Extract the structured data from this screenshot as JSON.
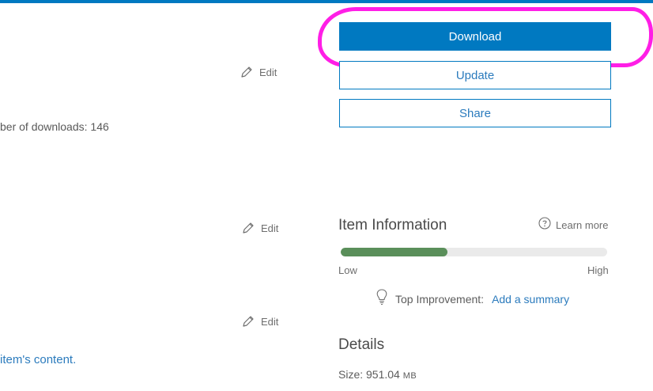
{
  "left": {
    "edit_label": "Edit",
    "downloads_text": "ber of downloads: 146",
    "content_link": "item's content."
  },
  "actions": {
    "download_label": "Download",
    "update_label": "Update",
    "share_label": "Share"
  },
  "item_information": {
    "title": "Item Information",
    "learn_more": "Learn more",
    "progress_fraction": 0.4,
    "low_label": "Low",
    "high_label": "High",
    "top_improvement_label": "Top Improvement:",
    "top_improvement_link": "Add a summary"
  },
  "details": {
    "title": "Details",
    "size_label": "Size: 951.04",
    "size_unit": "MB"
  },
  "colors": {
    "accent": "#0079c1",
    "progress": "#5a8f5a",
    "highlight": "#ff1ee6"
  },
  "icons": [
    "pencil-icon",
    "question-circle-icon",
    "lightbulb-icon"
  ]
}
